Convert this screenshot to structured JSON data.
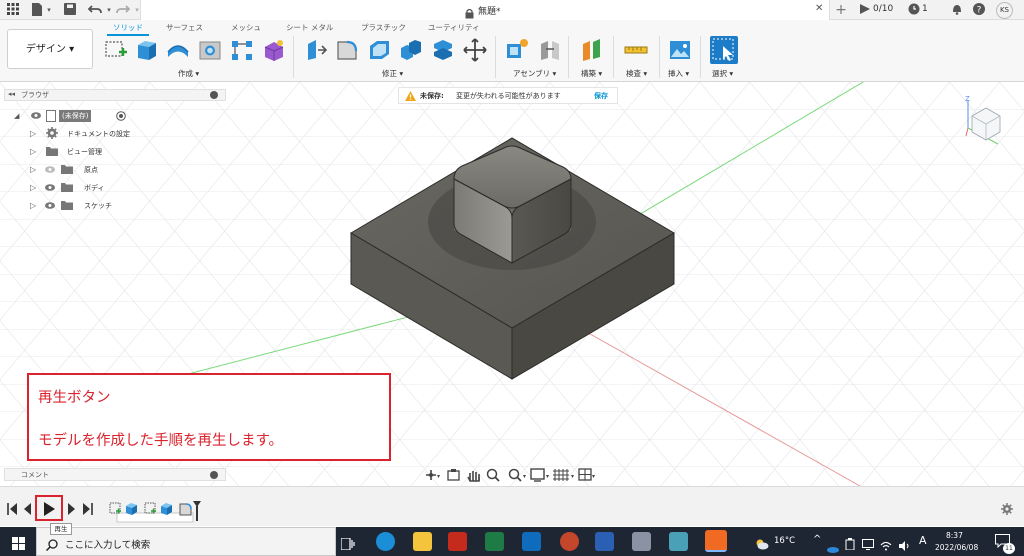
{
  "titlebar": {
    "doc_title": "無題*",
    "job_count": "0/10",
    "clock_count": "1",
    "user_initials": "KS"
  },
  "ribbon": {
    "workspace": "デザイン ▾",
    "tabs": [
      "ソリッド",
      "サーフェス",
      "メッシュ",
      "シート メタル",
      "プラスチック",
      "ユーティリティ"
    ],
    "groups": [
      "作成 ▾",
      "修正 ▾",
      "アセンブリ ▾",
      "構築 ▾",
      "検査 ▾",
      "挿入 ▾",
      "選択 ▾"
    ]
  },
  "browser": {
    "title": "ブラウザ",
    "items": [
      "(未保存)",
      "ドキュメントの設定",
      "ビュー管理",
      "原点",
      "ボディ",
      "スケッチ"
    ]
  },
  "warning": {
    "label": "未保存:",
    "message": "変更が失われる可能性があります",
    "save": "保存"
  },
  "annotation": {
    "line1": "再生ボタン",
    "line2": "モデルを作成した手順を再生します。"
  },
  "comment": {
    "label": "コメント"
  },
  "timeline": {
    "tooltip": "再生"
  },
  "taskbar": {
    "search_placeholder": "ここに入力して検索",
    "temperature": "16°C",
    "ime": "A",
    "time": "8:37",
    "date": "2022/06/08",
    "notifications": "11"
  }
}
